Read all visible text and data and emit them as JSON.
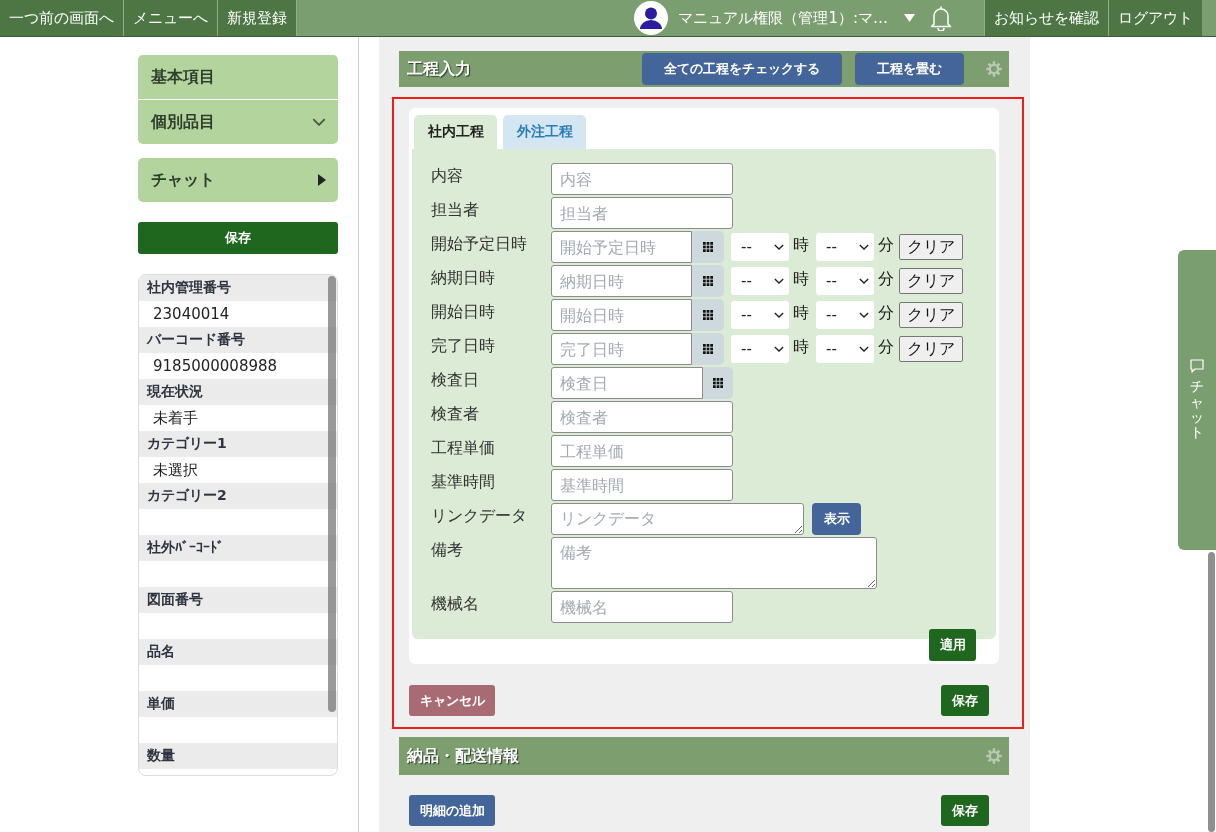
{
  "top_bar": {
    "nav_buttons": [
      "一つ前の画面へ",
      "メニューへ",
      "新規登録"
    ],
    "user_name": "マニュアル権限（管理1）:マ…",
    "action_buttons": [
      "お知らせを確認",
      "ログアウト"
    ]
  },
  "sidebar": {
    "nav_groups": [
      {
        "items": [
          {
            "label": "基本項目",
            "kind": "plain"
          },
          {
            "label": "個別品目",
            "kind": "dropdown"
          }
        ]
      },
      {
        "items": [
          {
            "label": "チャット",
            "kind": "submenu"
          }
        ]
      }
    ],
    "save_button": "保存",
    "details": [
      {
        "label": "社内管理番号",
        "value": "23040014"
      },
      {
        "label": "バーコード番号",
        "value": "9185000008988"
      },
      {
        "label": "現在状況",
        "value": "未着手"
      },
      {
        "label": "カテゴリー1",
        "value": "未選択"
      },
      {
        "label": "カテゴリー2"
      },
      {
        "label": "社外ﾊﾞｰｺｰﾄﾞ"
      },
      {
        "label": "図面番号"
      },
      {
        "label": "品名"
      },
      {
        "label": "単価"
      },
      {
        "label": "数量"
      }
    ]
  },
  "process_section": {
    "title": "工程入力",
    "header_buttons": [
      "全ての工程をチェックする",
      "工程を畳む"
    ],
    "tabs": [
      {
        "label": "社内工程",
        "selected": true
      },
      {
        "label": "外注工程",
        "selected": false
      }
    ],
    "fields": [
      {
        "label": "内容",
        "kind": "text",
        "placeholder": "内容"
      },
      {
        "label": "担当者",
        "kind": "text",
        "placeholder": "担当者"
      },
      {
        "label": "開始予定日時",
        "kind": "datetime",
        "placeholder": "開始予定日時",
        "hour": "--",
        "hour_unit": "時",
        "minute": "--",
        "minute_unit": "分",
        "clear_button": "クリア"
      },
      {
        "label": "納期日時",
        "kind": "datetime",
        "placeholder": "納期日時",
        "hour": "--",
        "hour_unit": "時",
        "minute": "--",
        "minute_unit": "分",
        "clear_button": "クリア"
      },
      {
        "label": "開始日時",
        "kind": "datetime",
        "placeholder": "開始日時",
        "hour": "--",
        "hour_unit": "時",
        "minute": "--",
        "minute_unit": "分",
        "clear_button": "クリア"
      },
      {
        "label": "完了日時",
        "kind": "datetime",
        "placeholder": "完了日時",
        "hour": "--",
        "hour_unit": "時",
        "minute": "--",
        "minute_unit": "分",
        "clear_button": "クリア"
      },
      {
        "label": "検査日",
        "kind": "date",
        "placeholder": "検査日"
      },
      {
        "label": "検査者",
        "kind": "text",
        "placeholder": "検査者"
      },
      {
        "label": "工程単価",
        "kind": "text",
        "placeholder": "工程単価"
      },
      {
        "label": "基準時間",
        "kind": "text",
        "placeholder": "基準時間"
      },
      {
        "label": "リンクデータ",
        "kind": "link",
        "placeholder": "リンクデータ",
        "button": "表示"
      },
      {
        "label": "備考",
        "kind": "memo",
        "placeholder": "備考"
      },
      {
        "label": "機械名",
        "kind": "text",
        "placeholder": "機械名"
      }
    ],
    "apply_button": "適用",
    "cancel_button": "キャンセル",
    "save_button": "保存"
  },
  "delivery_section": {
    "title": "納品・配送情報",
    "add_button": "明細の追加",
    "save_button": "保存"
  },
  "chat_tab": {
    "label": "チャット"
  }
}
